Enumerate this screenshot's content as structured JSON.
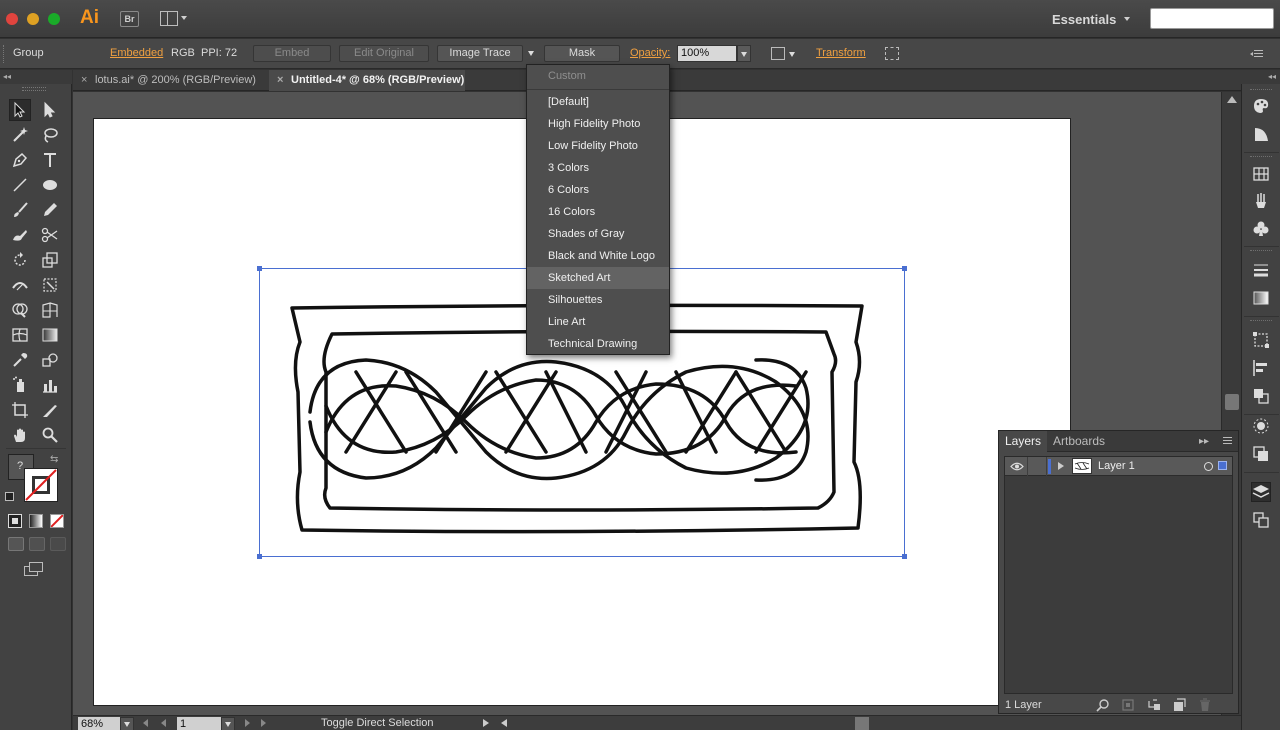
{
  "app": {
    "logo": "Ai",
    "bridge_label": "Br",
    "workspace": "Essentials",
    "search_value": ""
  },
  "control_bar": {
    "selection_type": "Group",
    "embedded_label": "Embedded",
    "color_mode": "RGB",
    "ppi_label": "PPI: 72",
    "embed_btn": "Embed",
    "edit_original_btn": "Edit Original",
    "image_trace_btn": "Image Trace",
    "mask_btn": "Mask",
    "opacity_label": "Opacity:",
    "opacity_value": "100%",
    "transform_label": "Transform"
  },
  "tabs": [
    {
      "label": "lotus.ai* @ 200% (RGB/Preview)",
      "active": false
    },
    {
      "label": "Untitled-4* @ 68% (RGB/Preview)",
      "active": true
    }
  ],
  "trace_presets": {
    "header": "Custom",
    "items": [
      "[Default]",
      "High Fidelity Photo",
      "Low Fidelity Photo",
      "3 Colors",
      "6 Colors",
      "16 Colors",
      "Shades of Gray",
      "Black and White Logo",
      "Sketched Art",
      "Silhouettes",
      "Line Art",
      "Technical Drawing"
    ],
    "hovered": "Sketched Art"
  },
  "status_bar": {
    "zoom": "68%",
    "page": "1",
    "status_text": "Toggle Direct Selection"
  },
  "layers_panel": {
    "tabs": [
      "Layers",
      "Artboards"
    ],
    "active_tab": "Layers",
    "layer_name": "Layer 1",
    "layer_count": "1 Layer",
    "layer_color": "#4a6fd1"
  },
  "colors": {
    "accent_orange": "#f8951d",
    "selection_blue": "#4a6fd1",
    "ui_background": "#535353"
  }
}
